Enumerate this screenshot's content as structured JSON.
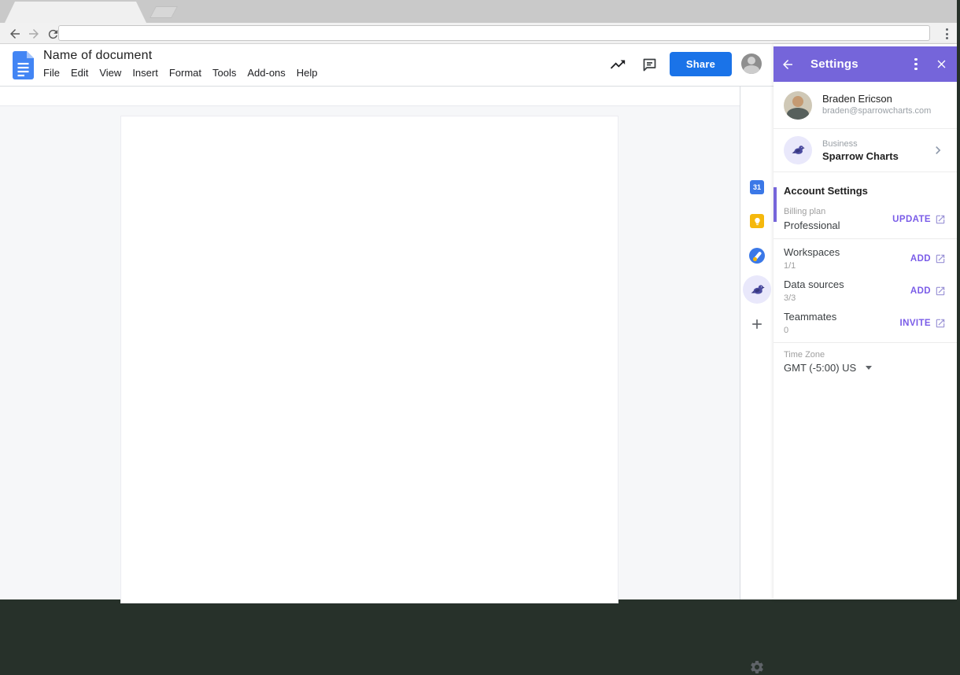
{
  "colors": {
    "panel_accent": "#7565da",
    "action_link": "#7a5ce8",
    "share_button": "#1a73e8",
    "docs_icon_blue": "#4285f4",
    "calendar_blue": "#3b78e7",
    "keep_yellow": "#f5b80c"
  },
  "browser": {
    "address_value": ""
  },
  "docs": {
    "title": "Name of document",
    "menu": [
      "File",
      "Edit",
      "View",
      "Insert",
      "Format",
      "Tools",
      "Add-ons",
      "Help"
    ],
    "share_label": "Share"
  },
  "addon_bar": {
    "calendar_label": "31"
  },
  "panel": {
    "title": "Settings",
    "user": {
      "name": "Braden Ericson",
      "email": "braden@sparrowcharts.com"
    },
    "business": {
      "type_label": "Business",
      "name": "Sparrow Charts"
    },
    "section_title": "Account Settings",
    "rows": [
      {
        "label": "Billing plan",
        "value": "Professional",
        "action": "UPDATE"
      },
      {
        "label": "Workspaces",
        "value": "1/1",
        "action": "ADD"
      },
      {
        "label": "Data sources",
        "value": "3/3",
        "action": "ADD"
      },
      {
        "label": "Teammates",
        "value": "0",
        "action": "INVITE"
      }
    ],
    "timezone": {
      "label": "Time Zone",
      "value": "GMT (-5:00) US"
    }
  }
}
